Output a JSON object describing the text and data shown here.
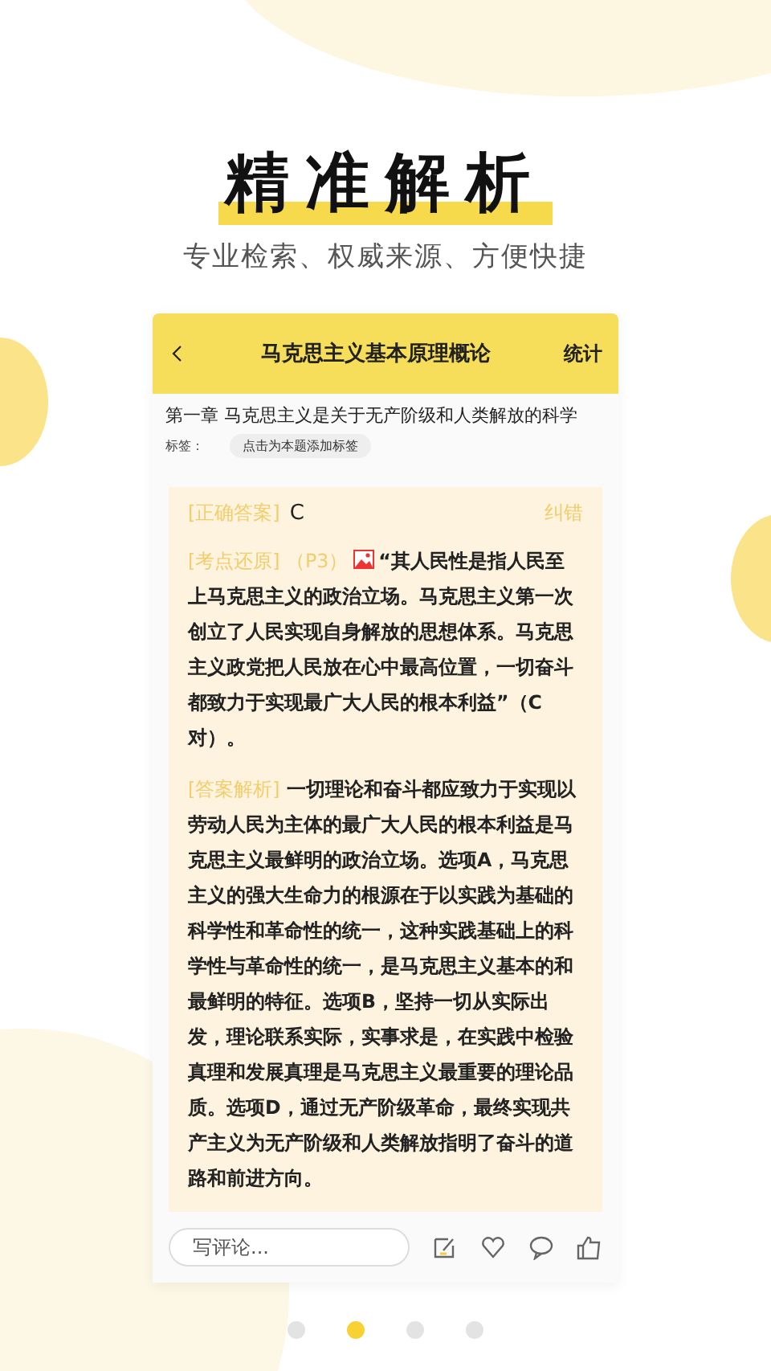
{
  "hero": {
    "title": "精准解析",
    "subtitle": "专业检索、权威来源、方便快捷"
  },
  "header": {
    "title": "马克思主义基本原理概论",
    "action": "统计"
  },
  "chapter": "第一章 马克思主义是关于无产阶级和人类解放的科学",
  "tags": {
    "label": "标签：",
    "button": "点击为本题添加标签"
  },
  "answer": {
    "label": "[正确答案]",
    "value": "C",
    "report": "纠错"
  },
  "point": {
    "label": "[考点还原]",
    "page": "（P3）",
    "text": "“其人民性是指人民至上马克思主义的政治立场。马克思主义第一次创立了人民实现自身解放的思想体系。马克思主义政党把人民放在心中最高位置，一切奋斗都致力于实现最广大人民的根本利益”（C对）。"
  },
  "analysis": {
    "label": "[答案解析]",
    "text": "一切理论和奋斗都应致力于实现以劳动人民为主体的最广大人民的根本利益是马克思主义最鲜明的政治立场。选项A，马克思主义的强大生命力的根源在于以实践为基础的科学性和革命性的统一，这种实践基础上的科学性与革命性的统一，是马克思主义基本的和最鲜明的特征。选项B，坚持一切从实际出发，理论联系实际，实事求是，在实践中检验真理和发展真理是马克思主义最重要的理论品质。选项D，通过无产阶级革命，最终实现共产主义为无产阶级和人类解放指明了奋斗的道路和前进方向。"
  },
  "comment": {
    "placeholder": "写评论..."
  },
  "pages": [
    {
      "selected": false
    },
    {
      "selected": true
    },
    {
      "selected": false
    },
    {
      "selected": false
    }
  ]
}
